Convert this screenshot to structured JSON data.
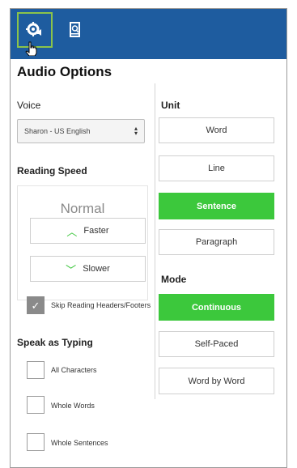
{
  "toolbar": {
    "tabs": [
      {
        "icon": "gear-audio-icon"
      },
      {
        "icon": "book-icon"
      }
    ]
  },
  "panel": {
    "title": "Audio Options"
  },
  "voice": {
    "label": "Voice",
    "selected": "Sharon - US English"
  },
  "reading_speed": {
    "label": "Reading Speed",
    "value": "Normal",
    "faster_label": "Faster",
    "slower_label": "Slower"
  },
  "skip_headers": {
    "label": "Skip Reading Headers/Footers",
    "checked": true
  },
  "speak_as_typing": {
    "label": "Speak as Typing",
    "options": [
      "All Characters",
      "Whole Words",
      "Whole Sentences"
    ]
  },
  "unit": {
    "label": "Unit",
    "options": [
      "Word",
      "Line",
      "Sentence",
      "Paragraph"
    ],
    "selected": "Sentence"
  },
  "mode": {
    "label": "Mode",
    "options": [
      "Continuous",
      "Self-Paced",
      "Word by Word"
    ],
    "selected": "Continuous"
  },
  "colors": {
    "topbar": "#1e5c9f",
    "accent_green": "#3cc83c",
    "active_tab_border": "#8bc34a"
  }
}
